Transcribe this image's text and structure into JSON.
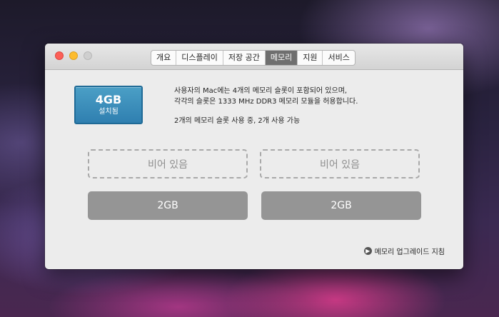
{
  "tabs": [
    {
      "label": "개요"
    },
    {
      "label": "디스플레이"
    },
    {
      "label": "저장 공간"
    },
    {
      "label": "메모리"
    },
    {
      "label": "지원"
    },
    {
      "label": "서비스"
    }
  ],
  "memory": {
    "amount": "4GB",
    "status": "설치됨",
    "description_line1": "사용자의 Mac에는 4개의 메모리 슬롯이 포함되어 있으며,",
    "description_line2": "각각의 슬롯은 1333 MHz DDR3 메모리 모듈을 허용합니다.",
    "usage": "2개의 메모리 슬롯 사용 중, 2개 사용 가능"
  },
  "slots": [
    {
      "label": "비어 있음",
      "state": "empty"
    },
    {
      "label": "비어 있음",
      "state": "empty"
    },
    {
      "label": "2GB",
      "state": "filled"
    },
    {
      "label": "2GB",
      "state": "filled"
    }
  ],
  "upgrade_link": {
    "label": "메모리 업그레이드 지침",
    "icon": "arrow-right-circle-icon"
  },
  "colors": {
    "accent": "#2f7fb0",
    "active_tab": "#6f6f6f",
    "filled_slot": "#959595"
  }
}
